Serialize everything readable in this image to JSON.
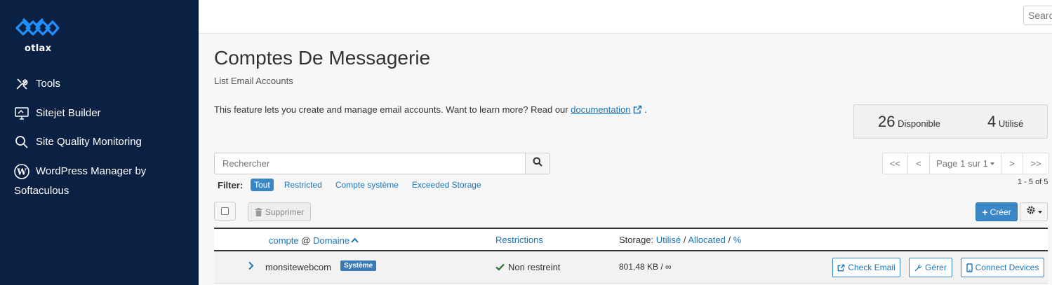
{
  "brand": {
    "name": "otlax",
    "color": "#1e90ff"
  },
  "sidebar": {
    "items": [
      {
        "label": "Tools",
        "icon": "tools-icon"
      },
      {
        "label": "Sitejet Builder",
        "icon": "monitor-icon"
      },
      {
        "label": "Site Quality Monitoring",
        "icon": "search-icon"
      },
      {
        "label": "WordPress Manager by Softaculous",
        "icon": "wordpress-icon"
      }
    ]
  },
  "topbar": {
    "search_placeholder": "Search"
  },
  "page": {
    "title": "Comptes De Messagerie",
    "subtitle": "List Email Accounts",
    "description": "This feature lets you create and manage email accounts. Want to learn more? Read our",
    "doc_link": "documentation",
    "description_end": "."
  },
  "stats": {
    "available_num": "26",
    "available_label": "Disponible",
    "used_num": "4",
    "used_label": "Utilisé"
  },
  "search": {
    "placeholder": "Rechercher"
  },
  "filter": {
    "label": "Filter:",
    "options": [
      "Tout",
      "Restricted",
      "Compte système",
      "Exceeded Storage"
    ],
    "active": "Tout"
  },
  "pager": {
    "first": "<<",
    "prev": "<",
    "page": "Page 1 sur 1",
    "next": ">",
    "last": ">>",
    "count": "1 - 5 of 5"
  },
  "toolbar": {
    "delete_label": "Supprimer",
    "create_label": "Créer"
  },
  "table": {
    "header": {
      "account": "compte",
      "at": "@",
      "domain": "Domaine",
      "restrictions": "Restrictions",
      "storage_label": "Storage:",
      "used": "Utilisé",
      "sep1": "/",
      "allocated": "Allocated",
      "sep2": "/",
      "percent": "%"
    },
    "rows": [
      {
        "account": "monsitewebcom",
        "badge": "Système",
        "restriction": "Non restreint",
        "storage": "801,48 KB / ∞",
        "actions": {
          "check_email": "Check Email",
          "manage": "Gérer",
          "connect": "Connect Devices"
        }
      }
    ]
  },
  "colors": {
    "sidebar_bg": "#0b2144",
    "accent": "#3a87c8",
    "link": "#1d75b8",
    "success": "#3c763d"
  }
}
